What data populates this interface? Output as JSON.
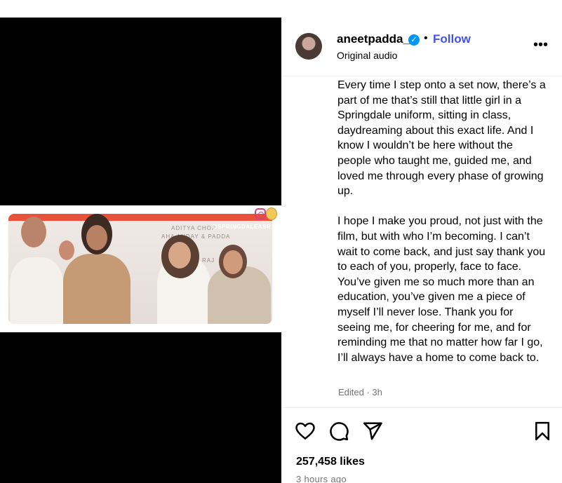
{
  "post": {
    "username": "aneetpadda_",
    "follow_label": "Follow",
    "dot": "•",
    "subtitle": "Original audio",
    "more_label": "•••",
    "caption": [
      "Every time I step onto a set now, there’s a part of me that’s still that little girl in a Springdale uniform, sitting in class, daydreaming about this exact life. And I know I wouldn’t be here without the people who taught me, guided me, and loved me through every phase of growing up.",
      "I hope I make you proud, not just with the film, but with who I’m becoming. I can’t wait to come back, and just say thank you to each of you, properly, face to face. You’ve given me so much more than an education, you’ve given me a piece of myself I’ll never lose. Thank you for seeing me, for cheering for me, and for reminding me that no matter how far I go, I’ll always have a home to come back to."
    ],
    "edited": "Edited · 3h",
    "likes": "257,458 likes",
    "time": "3 hours ago"
  },
  "photo": {
    "watermark": "@SPRINGDALEASR",
    "banner_line1": "ADITYA CHOP",
    "banner_line2": "AHA    ANDAY &    PADDA",
    "banner_line3": "RAJ"
  },
  "icons": {
    "verified": "verified-badge-icon",
    "like": "heart-icon",
    "comment": "comment-icon",
    "share": "send-icon",
    "save": "bookmark-icon",
    "more": "more-options-icon"
  },
  "colors": {
    "follow": "#4150f7",
    "verified": "#0095f6",
    "muted": "#737373",
    "banner_red": "#e8523b"
  }
}
